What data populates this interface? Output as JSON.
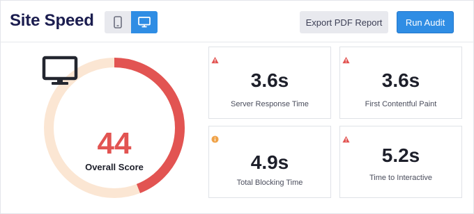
{
  "header": {
    "title": "Site Speed",
    "device_toggle": {
      "options": [
        "mobile",
        "desktop"
      ],
      "selected": "desktop"
    },
    "export_label": "Export PDF Report",
    "run_label": "Run Audit"
  },
  "score": {
    "value": "44",
    "label": "Overall Score",
    "fraction": 0.44,
    "color": "#e25452",
    "track_color": "#fbe6d3",
    "icon": "monitor-icon"
  },
  "metrics": [
    {
      "value": "3.6s",
      "label": "Server Response Time",
      "status": "warning",
      "status_icon": "warning-triangle-icon"
    },
    {
      "value": "3.6s",
      "label": "First Contentful Paint",
      "status": "warning",
      "status_icon": "warning-triangle-icon"
    },
    {
      "value": "4.9s",
      "label": "Total Blocking Time",
      "status": "info",
      "status_icon": "info-circle-icon"
    },
    {
      "value": "5.2s",
      "label": "Time to Interactive",
      "status": "warning",
      "status_icon": "warning-triangle-icon"
    }
  ],
  "colors": {
    "accent": "#2f8de4",
    "title": "#1b1d4f",
    "warning": "#e25452",
    "info": "#f0a34a"
  }
}
